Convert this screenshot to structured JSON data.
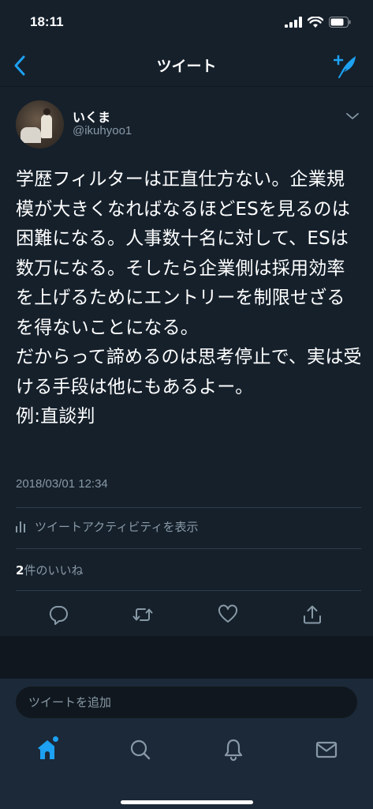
{
  "status_bar": {
    "time": "18:11"
  },
  "nav": {
    "title": "ツイート"
  },
  "tweet": {
    "user_name": "いくま",
    "user_handle": "@ikuhyoo1",
    "text": "学歴フィルターは正直仕方ない。企業規模が大きくなればなるほどESを見るのは困難になる。人事数十名に対して、ESは数万になる。そしたら企業側は採用効率を上げるためにエントリーを制限せざるを得ないことになる。\nだからって諦めるのは思考停止で、実は受ける手段は他にもあるよー。\n例:直談判",
    "timestamp": "2018/03/01 12:34",
    "activity_label": "ツイートアクティビティを表示",
    "likes_count": "2",
    "likes_label": "件のいいね"
  },
  "reply": {
    "placeholder": "ツイートを追加"
  },
  "icons": {
    "back": "chevron-left-icon",
    "compose": "compose-tweet-icon",
    "reply": "reply-icon",
    "retweet": "retweet-icon",
    "like": "heart-icon",
    "share": "share-icon",
    "home": "home-icon",
    "search": "search-icon",
    "notifications": "bell-icon",
    "messages": "mail-icon"
  },
  "colors": {
    "background": "#15202b",
    "accent": "#1da1f2",
    "muted": "#8899a6"
  }
}
